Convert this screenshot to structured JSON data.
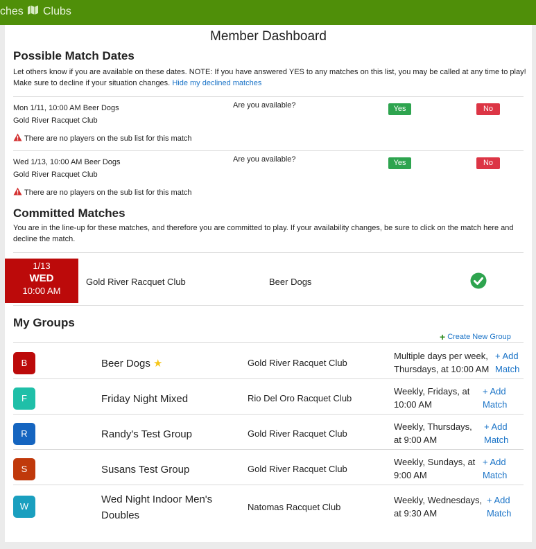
{
  "topbar": {
    "prev_label": "ches",
    "clubs_label": "Clubs",
    "color": "#4f8f09"
  },
  "title": "Member Dashboard",
  "possible": {
    "heading": "Possible Match Dates",
    "desc": "Let others know if you are available on these dates.   NOTE: If you have answered YES to any matches on this list, you may be called at any time to play!   Make sure to decline if your situation changes.",
    "hide_link": "Hide my declined matches",
    "matches": [
      {
        "line1": "Mon 1/11, 10:00 AM  Beer Dogs",
        "line2": "Gold River Racquet Club",
        "avail": "Are you available?",
        "yes": "Yes",
        "no": "No",
        "warn": "There are no players on the sub list for this match"
      },
      {
        "line1": "Wed 1/13, 10:00 AM  Beer Dogs",
        "line2": "Gold River Racquet Club",
        "avail": "Are you available?",
        "yes": "Yes",
        "no": "No",
        "warn": "There are no players on the sub list for this match"
      }
    ]
  },
  "committed": {
    "heading": "Committed Matches",
    "desc": "You are in the line-up for these matches, and therefore you are committed to play. If your availability changes, be sure to click on the match here and decline the match.",
    "match": {
      "date": "1/13",
      "day": "WED",
      "time": "10:00 AM",
      "club": "Gold River Racquet Club",
      "group": "Beer Dogs"
    }
  },
  "groups": {
    "heading": "My Groups",
    "create_label": "Create New Group",
    "items": [
      {
        "letter": "B",
        "color": "#bc0a0a",
        "name": "Beer Dogs",
        "star": "★",
        "club": "Gold River Racquet Club",
        "schedule": "Multiple days per week, Thursdays, at 10:00 AM",
        "add_line1": "+ Add",
        "add_line2": "Match"
      },
      {
        "letter": "F",
        "color": "#1fbfa8",
        "name": "Friday Night Mixed",
        "club": "Rio Del Oro Racquet Club",
        "schedule": "Weekly, Fridays, at 10:00 AM",
        "add_line1": "+ Add",
        "add_line2": "Match"
      },
      {
        "letter": "R",
        "color": "#1565c0",
        "name": "Randy's Test Group",
        "club": "Gold River Racquet Club",
        "schedule": "Weekly, Thursdays, at 9:00 AM",
        "add_line1": "+ Add",
        "add_line2": "Match"
      },
      {
        "letter": "S",
        "color": "#c0390b",
        "name": "Susans Test Group",
        "club": "Gold River Racquet Club",
        "schedule": "Weekly, Sundays, at 9:00 AM",
        "add_line1": "+ Add",
        "add_line2": "Match"
      },
      {
        "letter": "W",
        "color": "#1a9fbf",
        "name": "Wed Night Indoor Men's Doubles",
        "club": "Natomas Racquet Club",
        "schedule": "Weekly, Wednesdays, at 9:30 AM",
        "add_line1": "+ Add",
        "add_line2": "Match"
      }
    ]
  }
}
